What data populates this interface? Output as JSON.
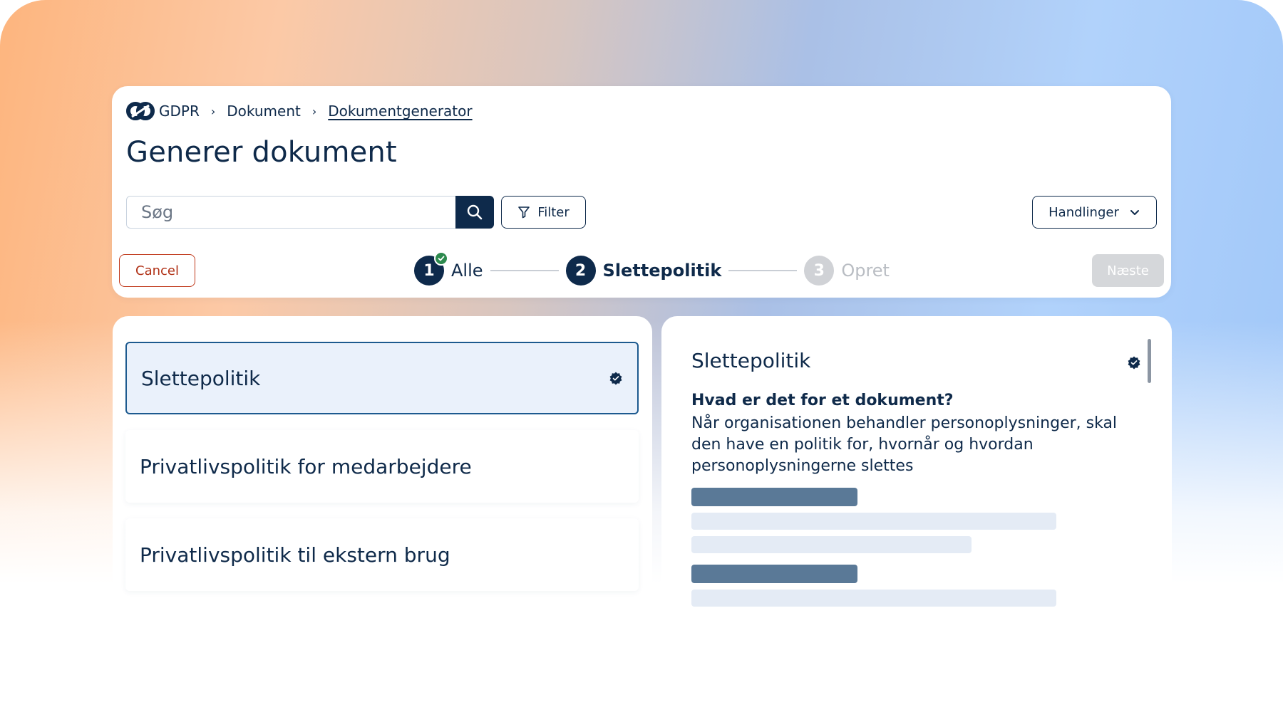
{
  "breadcrumb": {
    "root": "GDPR",
    "items": [
      "Dokument",
      "Dokumentgenerator"
    ],
    "separator": "›"
  },
  "page": {
    "title": "Generer dokument"
  },
  "search": {
    "placeholder": "Søg"
  },
  "toolbar": {
    "filter_label": "Filter",
    "actions_label": "Handlinger"
  },
  "wizard": {
    "cancel_label": "Cancel",
    "next_label": "Næste",
    "steps": [
      {
        "number": "1",
        "label": "Alle",
        "state": "completed"
      },
      {
        "number": "2",
        "label": "Slettepolitik",
        "state": "active"
      },
      {
        "number": "3",
        "label": "Opret",
        "state": "inactive"
      }
    ]
  },
  "documents": [
    {
      "title": "Slettepolitik",
      "selected": true,
      "badge": "verified-badge-icon"
    },
    {
      "title": "Privatlivspolitik for medarbejdere",
      "selected": false
    },
    {
      "title": "Privatlivspolitik til ekstern brug",
      "selected": false
    }
  ],
  "detail": {
    "title": "Slettepolitik",
    "question": "Hvad er det for et dokument?",
    "description": "Når organisationen behandler personoplysninger, skal den have en politik for, hvornår og hvordan personoplysningerne slettes"
  },
  "colors": {
    "primary": "#0e2a4b",
    "danger": "#c0391b",
    "success": "#2d8a4e",
    "selected_bg": "#eaf1fb",
    "disabled": "#d5d7da"
  }
}
